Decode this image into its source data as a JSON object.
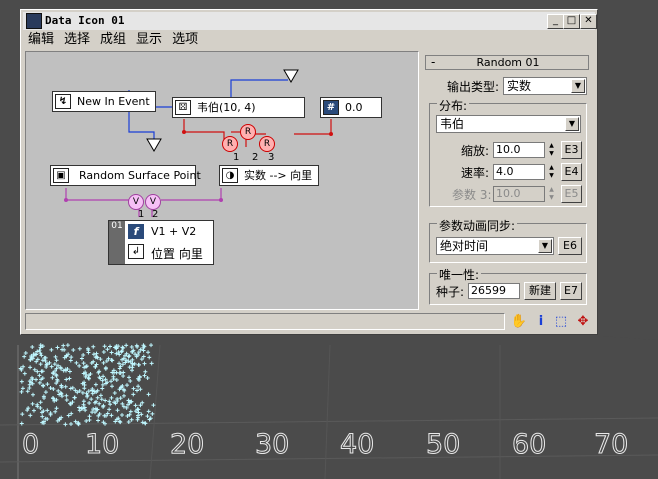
{
  "window": {
    "title": "Data Icon 01",
    "controls": {
      "minimize": "_",
      "maximize": "□",
      "close": "✕"
    }
  },
  "menu": [
    "编辑",
    "选择",
    "成组",
    "显示",
    "选项"
  ],
  "graph": {
    "nodes": {
      "new_in_event": "New In Event",
      "weibull": "韦伯(10, 4)",
      "zero": "0.0",
      "random_surface_point": "Random Surface Point",
      "real_to_vector": "实数 --> 向里",
      "expr_line1": "V1 + V2",
      "expr_line2": "位置 向里",
      "expr_id": "01"
    },
    "ports": {
      "r": "R",
      "v": "V",
      "n1": "1",
      "n2": "2",
      "n3": "3"
    }
  },
  "panel": {
    "title": "Random 01",
    "collapse": "-",
    "output_type_label": "输出类型:",
    "output_type_value": "实数",
    "distribution_label": "分布:",
    "distribution_value": "韦伯",
    "scale_label": "缩放:",
    "scale_value": "10.0",
    "scale_btn": "E3",
    "rate_label": "速率:",
    "rate_value": "4.0",
    "rate_btn": "E4",
    "param3_label": "参数 3:",
    "param3_value": "10.0",
    "param3_btn": "E5",
    "sync_label": "参数动画同步:",
    "sync_value": "绝对时间",
    "sync_btn": "E6",
    "unique_label": "唯一性:",
    "seed_label": "种子:",
    "seed_value": "26599",
    "new_btn": "新建",
    "seed_btn": "E7"
  },
  "status": {
    "text": ""
  },
  "viewport_axis": [
    "0",
    "10",
    "20",
    "30",
    "40",
    "50",
    "60",
    "70"
  ],
  "colors": {
    "edge_blue": "#1a3fd6",
    "edge_red": "#d01010",
    "edge_purple": "#b040b0",
    "particles": "#bff7ff"
  }
}
